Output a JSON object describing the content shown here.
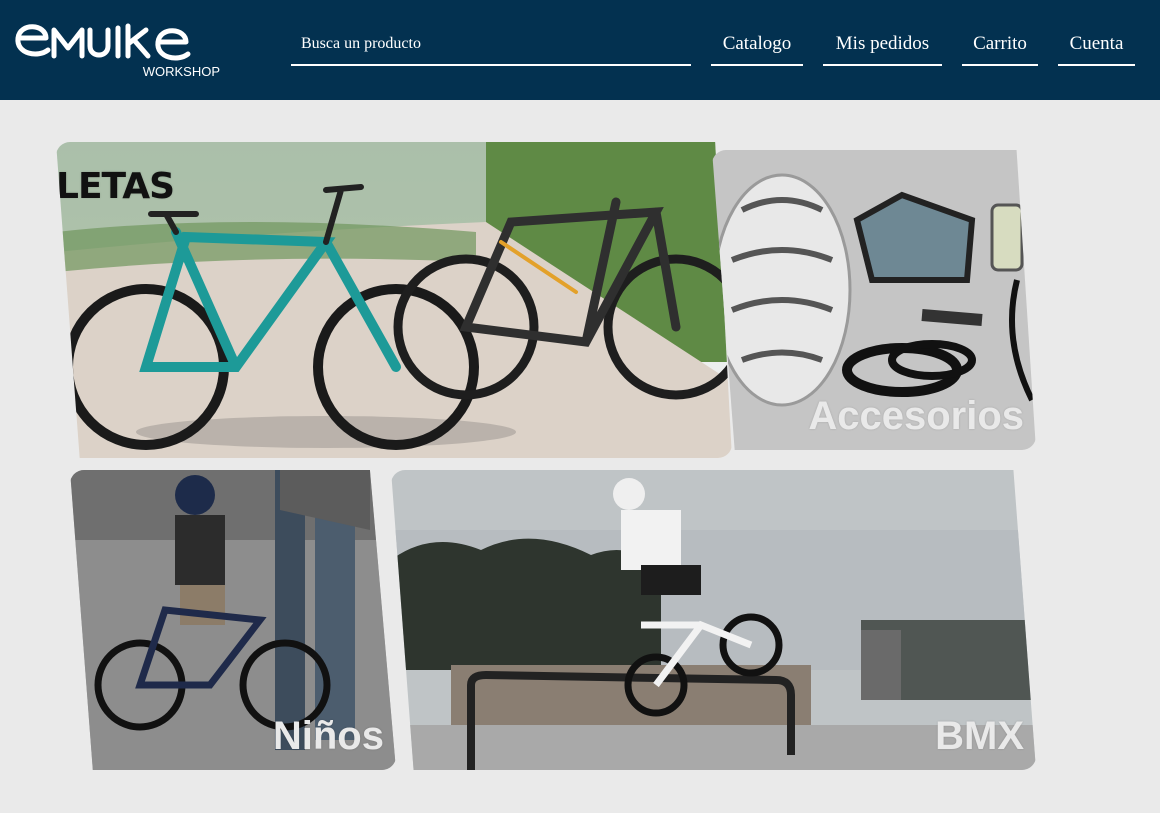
{
  "header": {
    "logo_text": "EMBIKE",
    "logo_sub": "WORKSHOP",
    "search_placeholder": "Busca un producto",
    "nav": {
      "catalogo": "Catalogo",
      "pedidos": "Mis pedidos",
      "carrito": "Carrito",
      "cuenta": "Cuenta"
    }
  },
  "categories": {
    "bicicletas": {
      "label": "LETAS"
    },
    "accesorios": {
      "label": "Accesorios"
    },
    "ninos": {
      "label": "Niños"
    },
    "bmx": {
      "label": "BMX"
    }
  },
  "colors": {
    "header_bg": "#033150",
    "page_bg": "#eaeaea",
    "label": "#e9e9e9"
  }
}
